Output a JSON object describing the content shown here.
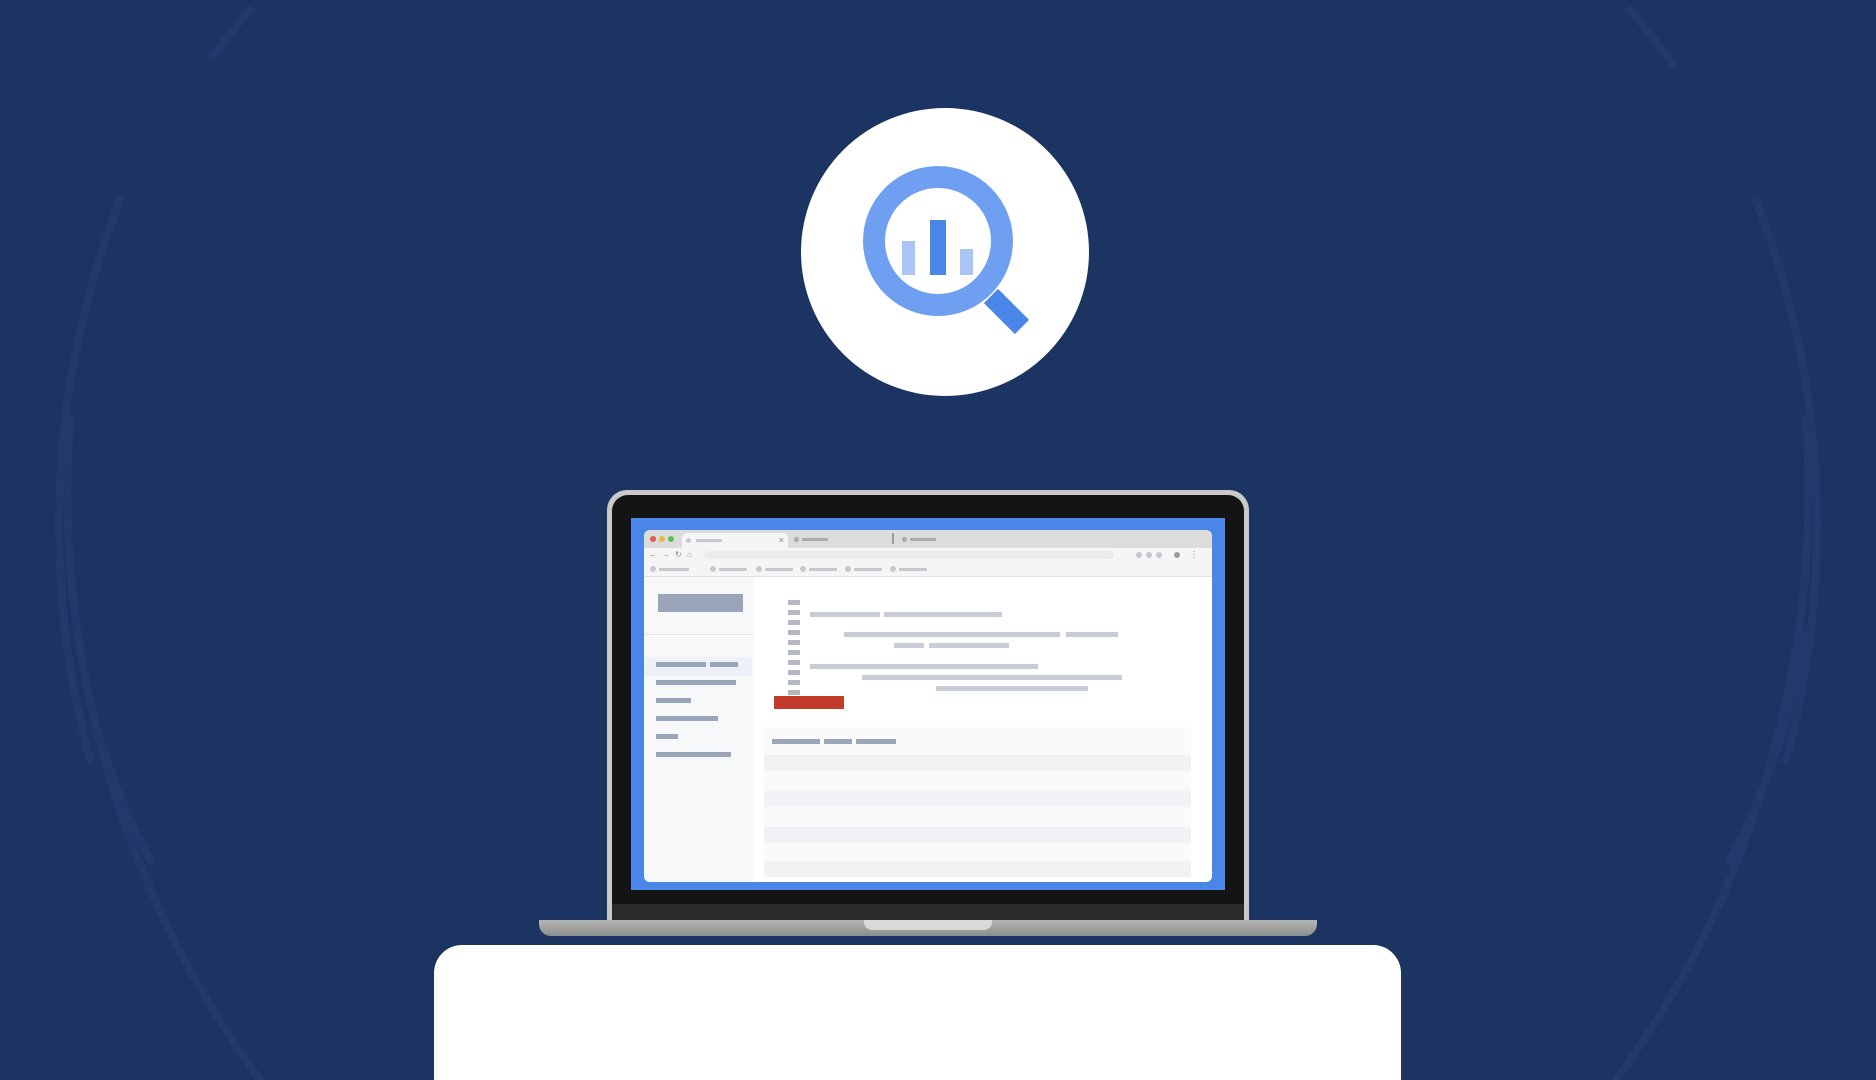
{
  "colors": {
    "background": "#1c3461",
    "arc": "#223a6b",
    "logo_circle": "#ffffff",
    "logo_blue": "#4a86e8",
    "logo_light_blue": "#a9c4f5",
    "screen_frame": "#4a86e8",
    "run_button": "#c23b2a",
    "pedestal": "#ffffff"
  },
  "logo": {
    "icon": "magnifier-bar-chart-icon"
  },
  "browser": {
    "tab_close_glyph": "×",
    "nav_glyphs": [
      "←",
      "→",
      "↻",
      "⌂"
    ]
  }
}
